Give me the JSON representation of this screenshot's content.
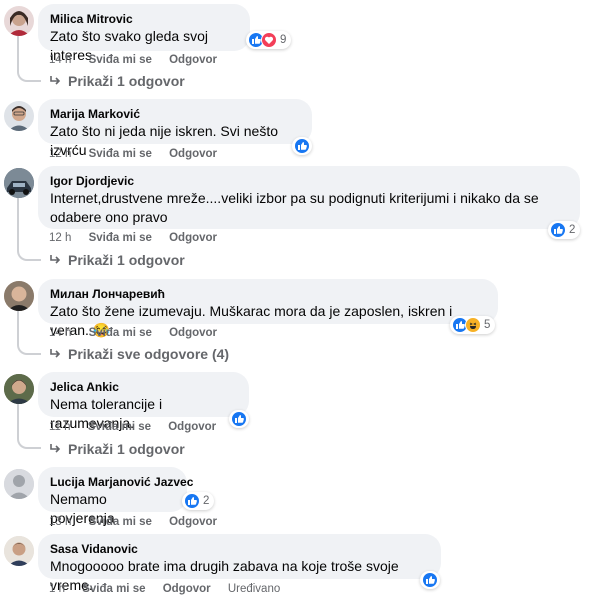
{
  "actions": {
    "like": "Sviđa mi se",
    "reply": "Odgovor",
    "edited": "Uređivano"
  },
  "comments": [
    {
      "author": "Milica Mitrovic",
      "text": "Zato što svako gleda svoj interes",
      "time": "14 h",
      "reactions": [
        "like-icon",
        "love-icon"
      ],
      "reaction_count": "9",
      "replies": "Prikaži 1 odgovor"
    },
    {
      "author": "Marija Marković",
      "text": "Zato što ni jeda nije iskren. Svi nešto izvrću",
      "time": "12 h",
      "reactions": [
        "like-icon"
      ]
    },
    {
      "author": "Igor Djordjevic",
      "text_line1": "Internet,drustvene mreže....veliki izbor pa su podignuti kriterijumi i nikako da se",
      "text_line2": "odabere ono pravo",
      "time": "12 h",
      "reactions": [
        "like-icon"
      ],
      "reaction_count": "2",
      "replies": "Prikaži 1 odgovor"
    },
    {
      "author": "Милан Лончаревић",
      "text": "Zato što žene izumevaju. Muškarac mora da je zaposlen, iskren i veran. 😂",
      "time": "14 h",
      "reactions": [
        "like-icon",
        "haha-icon"
      ],
      "reaction_count": "5",
      "replies": "Prikaži sve odgovore (4)"
    },
    {
      "author": "Jelica Ankic",
      "text": "Nema tolerancije i razumevanja.",
      "time": "11 h",
      "reactions": [
        "like-icon"
      ],
      "replies": "Prikaži 1 odgovor"
    },
    {
      "author": "Lucija Marjanović Jazvec",
      "text": "Nemamo povjerenja",
      "time": "13 h",
      "reactions": [
        "like-icon"
      ],
      "reaction_count": "2"
    },
    {
      "author": "Sasa Vidanovic",
      "text": "Mnogooooo brate ima drugih zabava na koje troše svoje vreme.",
      "time": "1 h",
      "reactions": [
        "like-icon"
      ]
    }
  ]
}
